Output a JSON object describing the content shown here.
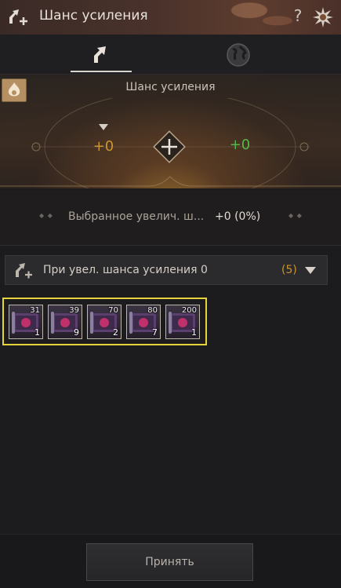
{
  "header": {
    "title": "Шанс усиления",
    "help_label": "?"
  },
  "tabs": [
    {
      "name": "enhance-tab",
      "icon": "arrow-up-icon",
      "active": true
    },
    {
      "name": "globe-tab",
      "icon": "globe-icon",
      "active": false
    }
  ],
  "panel": {
    "title": "Шанс усиления",
    "current_value": "+0",
    "target_value": "+0"
  },
  "summary": {
    "label": "Выбранное увелич. ш...",
    "value": "+0 (0%)"
  },
  "dropdown": {
    "label": "При увел. шанса усиления 0",
    "count": "(5)"
  },
  "items": [
    {
      "level": "31",
      "count": "1"
    },
    {
      "level": "39",
      "count": "9"
    },
    {
      "level": "70",
      "count": "2"
    },
    {
      "level": "80",
      "count": "7"
    },
    {
      "level": "200",
      "count": "1"
    }
  ],
  "footer": {
    "accept_label": "Принять"
  },
  "colors": {
    "gold": "#c9952e",
    "green": "#55b84a",
    "highlight": "#e6d23a"
  }
}
